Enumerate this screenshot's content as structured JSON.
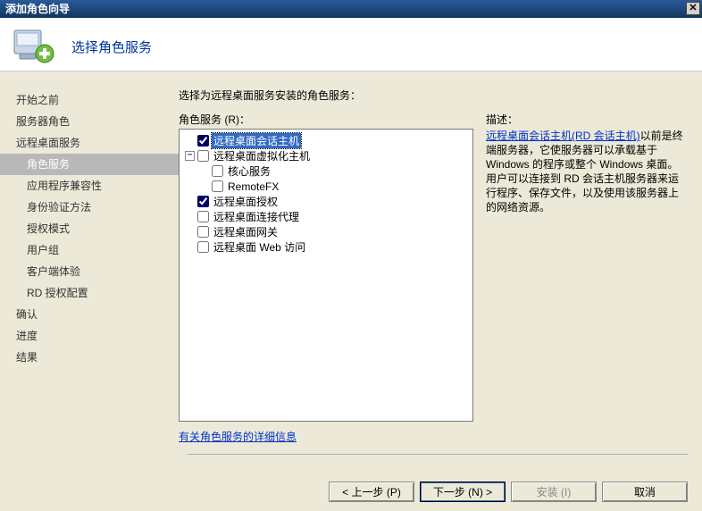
{
  "window": {
    "title": "添加角色向导",
    "close_glyph": "✕"
  },
  "header": {
    "title": "选择角色服务"
  },
  "nav": {
    "items": [
      {
        "label": "开始之前",
        "cls": "nav-item"
      },
      {
        "label": "服务器角色",
        "cls": "nav-item"
      },
      {
        "label": "远程桌面服务",
        "cls": "nav-item"
      },
      {
        "label": "角色服务",
        "cls": "nav-item nav-selected"
      },
      {
        "label": "应用程序兼容性",
        "cls": "nav-item nav-sub"
      },
      {
        "label": "身份验证方法",
        "cls": "nav-item nav-sub"
      },
      {
        "label": "授权模式",
        "cls": "nav-item nav-sub"
      },
      {
        "label": "用户组",
        "cls": "nav-item nav-sub"
      },
      {
        "label": "客户端体验",
        "cls": "nav-item nav-sub"
      },
      {
        "label": "RD 授权配置",
        "cls": "nav-item nav-sub"
      },
      {
        "label": "确认",
        "cls": "nav-item"
      },
      {
        "label": "进度",
        "cls": "nav-item"
      },
      {
        "label": "结果",
        "cls": "nav-item"
      }
    ]
  },
  "main": {
    "instruction": "选择为远程桌面服务安装的角色服务：",
    "services_label": "角色服务 (R)：",
    "description_label": "描述：",
    "more_link": "有关角色服务的详细信息"
  },
  "tree": {
    "expander_glyph": "−",
    "items": [
      {
        "indent": "indent1",
        "checked": true,
        "label": "远程桌面会话主机",
        "selected": true
      },
      {
        "indent": "",
        "checked": false,
        "label": "远程桌面虚拟化主机",
        "expander": true
      },
      {
        "indent": "indent2",
        "checked": false,
        "label": "核心服务"
      },
      {
        "indent": "indent2",
        "checked": false,
        "label": "RemoteFX"
      },
      {
        "indent": "indent1",
        "checked": true,
        "label": "远程桌面授权"
      },
      {
        "indent": "indent1",
        "checked": false,
        "label": "远程桌面连接代理"
      },
      {
        "indent": "indent1",
        "checked": false,
        "label": "远程桌面网关"
      },
      {
        "indent": "indent1",
        "checked": false,
        "label": "远程桌面 Web 访问"
      }
    ]
  },
  "description": {
    "link_text": "远程桌面会话主机(RD 会话主机)",
    "body": "以前是终端服务器，它使服务器可以承载基于 Windows 的程序或整个 Windows 桌面。用户可以连接到 RD 会话主机服务器来运行程序、保存文件，以及使用该服务器上的网络资源。"
  },
  "buttons": {
    "prev": "< 上一步 (P)",
    "next": "下一步 (N) >",
    "install": "安装 (I)",
    "cancel": "取消"
  }
}
